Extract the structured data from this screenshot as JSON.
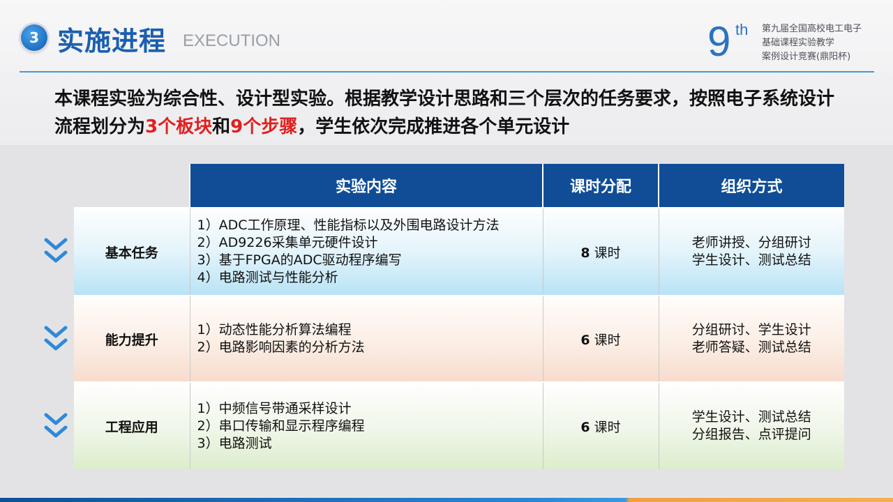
{
  "header": {
    "section_number": "3",
    "title_cn": "实施进程",
    "title_en": "EXECUTION",
    "logo_number": "9",
    "logo_suffix": "th",
    "competition_lines": [
      "第九届全国高校电工电子",
      "基础课程实验教学",
      "案例设计竞赛(鼎阳杯)"
    ]
  },
  "intro": {
    "part1": "本课程实验为综合性、设计型实验。根据教学设计思路和三个层次的任务要求，按照电子系统设计流程划分为",
    "highlight1": "3个板块",
    "part2": "和",
    "highlight2": "9个步骤",
    "part3": "，学生依次完成推进各个单元设计"
  },
  "table": {
    "headers": [
      "实验内容",
      "课时分配",
      "组织方式"
    ],
    "hours_unit": "课时",
    "rows": [
      {
        "label": "基本任务",
        "content": [
          "1）ADC工作原理、性能指标以及外围电路设计方法",
          "2）AD9226采集单元硬件设计",
          "3）基于FPGA的ADC驱动程序编写",
          "4）电路测试与性能分析"
        ],
        "hours": "8",
        "org": [
          "老师讲授、分组研讨",
          "学生设计、测试总结"
        ]
      },
      {
        "label": "能力提升",
        "content": [
          "1）动态性能分析算法编程",
          "2）电路影响因素的分析方法"
        ],
        "hours": "6",
        "org": [
          "分组研讨、学生设计",
          "老师答疑、测试总结"
        ]
      },
      {
        "label": "工程应用",
        "content": [
          "1）中频信号带通采样设计",
          "2）串口传输和显示程序编程",
          "3）电路测试"
        ],
        "hours": "6",
        "org": [
          "学生设计、测试总结",
          "分组报告、点评提问"
        ]
      }
    ]
  },
  "colors": {
    "accent_blue": "#104d96",
    "highlight_red": "#e0201f",
    "chevron_blue": "#2e8ad8"
  },
  "icons": {
    "chevron": "double-chevron-down-icon"
  }
}
